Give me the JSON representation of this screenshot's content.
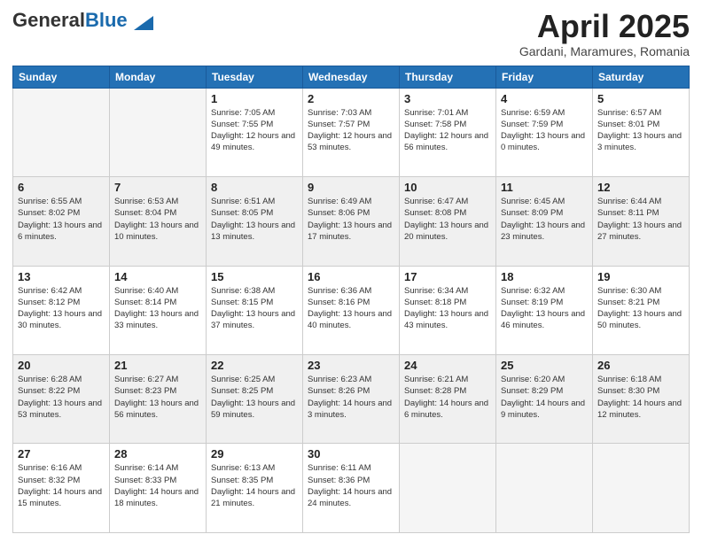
{
  "header": {
    "logo_general": "General",
    "logo_blue": "Blue",
    "month_title": "April 2025",
    "location": "Gardani, Maramures, Romania"
  },
  "weekdays": [
    "Sunday",
    "Monday",
    "Tuesday",
    "Wednesday",
    "Thursday",
    "Friday",
    "Saturday"
  ],
  "weeks": [
    [
      {
        "day": "",
        "sunrise": "",
        "sunset": "",
        "daylight": ""
      },
      {
        "day": "",
        "sunrise": "",
        "sunset": "",
        "daylight": ""
      },
      {
        "day": "1",
        "sunrise": "Sunrise: 7:05 AM",
        "sunset": "Sunset: 7:55 PM",
        "daylight": "Daylight: 12 hours and 49 minutes."
      },
      {
        "day": "2",
        "sunrise": "Sunrise: 7:03 AM",
        "sunset": "Sunset: 7:57 PM",
        "daylight": "Daylight: 12 hours and 53 minutes."
      },
      {
        "day": "3",
        "sunrise": "Sunrise: 7:01 AM",
        "sunset": "Sunset: 7:58 PM",
        "daylight": "Daylight: 12 hours and 56 minutes."
      },
      {
        "day": "4",
        "sunrise": "Sunrise: 6:59 AM",
        "sunset": "Sunset: 7:59 PM",
        "daylight": "Daylight: 13 hours and 0 minutes."
      },
      {
        "day": "5",
        "sunrise": "Sunrise: 6:57 AM",
        "sunset": "Sunset: 8:01 PM",
        "daylight": "Daylight: 13 hours and 3 minutes."
      }
    ],
    [
      {
        "day": "6",
        "sunrise": "Sunrise: 6:55 AM",
        "sunset": "Sunset: 8:02 PM",
        "daylight": "Daylight: 13 hours and 6 minutes."
      },
      {
        "day": "7",
        "sunrise": "Sunrise: 6:53 AM",
        "sunset": "Sunset: 8:04 PM",
        "daylight": "Daylight: 13 hours and 10 minutes."
      },
      {
        "day": "8",
        "sunrise": "Sunrise: 6:51 AM",
        "sunset": "Sunset: 8:05 PM",
        "daylight": "Daylight: 13 hours and 13 minutes."
      },
      {
        "day": "9",
        "sunrise": "Sunrise: 6:49 AM",
        "sunset": "Sunset: 8:06 PM",
        "daylight": "Daylight: 13 hours and 17 minutes."
      },
      {
        "day": "10",
        "sunrise": "Sunrise: 6:47 AM",
        "sunset": "Sunset: 8:08 PM",
        "daylight": "Daylight: 13 hours and 20 minutes."
      },
      {
        "day": "11",
        "sunrise": "Sunrise: 6:45 AM",
        "sunset": "Sunset: 8:09 PM",
        "daylight": "Daylight: 13 hours and 23 minutes."
      },
      {
        "day": "12",
        "sunrise": "Sunrise: 6:44 AM",
        "sunset": "Sunset: 8:11 PM",
        "daylight": "Daylight: 13 hours and 27 minutes."
      }
    ],
    [
      {
        "day": "13",
        "sunrise": "Sunrise: 6:42 AM",
        "sunset": "Sunset: 8:12 PM",
        "daylight": "Daylight: 13 hours and 30 minutes."
      },
      {
        "day": "14",
        "sunrise": "Sunrise: 6:40 AM",
        "sunset": "Sunset: 8:14 PM",
        "daylight": "Daylight: 13 hours and 33 minutes."
      },
      {
        "day": "15",
        "sunrise": "Sunrise: 6:38 AM",
        "sunset": "Sunset: 8:15 PM",
        "daylight": "Daylight: 13 hours and 37 minutes."
      },
      {
        "day": "16",
        "sunrise": "Sunrise: 6:36 AM",
        "sunset": "Sunset: 8:16 PM",
        "daylight": "Daylight: 13 hours and 40 minutes."
      },
      {
        "day": "17",
        "sunrise": "Sunrise: 6:34 AM",
        "sunset": "Sunset: 8:18 PM",
        "daylight": "Daylight: 13 hours and 43 minutes."
      },
      {
        "day": "18",
        "sunrise": "Sunrise: 6:32 AM",
        "sunset": "Sunset: 8:19 PM",
        "daylight": "Daylight: 13 hours and 46 minutes."
      },
      {
        "day": "19",
        "sunrise": "Sunrise: 6:30 AM",
        "sunset": "Sunset: 8:21 PM",
        "daylight": "Daylight: 13 hours and 50 minutes."
      }
    ],
    [
      {
        "day": "20",
        "sunrise": "Sunrise: 6:28 AM",
        "sunset": "Sunset: 8:22 PM",
        "daylight": "Daylight: 13 hours and 53 minutes."
      },
      {
        "day": "21",
        "sunrise": "Sunrise: 6:27 AM",
        "sunset": "Sunset: 8:23 PM",
        "daylight": "Daylight: 13 hours and 56 minutes."
      },
      {
        "day": "22",
        "sunrise": "Sunrise: 6:25 AM",
        "sunset": "Sunset: 8:25 PM",
        "daylight": "Daylight: 13 hours and 59 minutes."
      },
      {
        "day": "23",
        "sunrise": "Sunrise: 6:23 AM",
        "sunset": "Sunset: 8:26 PM",
        "daylight": "Daylight: 14 hours and 3 minutes."
      },
      {
        "day": "24",
        "sunrise": "Sunrise: 6:21 AM",
        "sunset": "Sunset: 8:28 PM",
        "daylight": "Daylight: 14 hours and 6 minutes."
      },
      {
        "day": "25",
        "sunrise": "Sunrise: 6:20 AM",
        "sunset": "Sunset: 8:29 PM",
        "daylight": "Daylight: 14 hours and 9 minutes."
      },
      {
        "day": "26",
        "sunrise": "Sunrise: 6:18 AM",
        "sunset": "Sunset: 8:30 PM",
        "daylight": "Daylight: 14 hours and 12 minutes."
      }
    ],
    [
      {
        "day": "27",
        "sunrise": "Sunrise: 6:16 AM",
        "sunset": "Sunset: 8:32 PM",
        "daylight": "Daylight: 14 hours and 15 minutes."
      },
      {
        "day": "28",
        "sunrise": "Sunrise: 6:14 AM",
        "sunset": "Sunset: 8:33 PM",
        "daylight": "Daylight: 14 hours and 18 minutes."
      },
      {
        "day": "29",
        "sunrise": "Sunrise: 6:13 AM",
        "sunset": "Sunset: 8:35 PM",
        "daylight": "Daylight: 14 hours and 21 minutes."
      },
      {
        "day": "30",
        "sunrise": "Sunrise: 6:11 AM",
        "sunset": "Sunset: 8:36 PM",
        "daylight": "Daylight: 14 hours and 24 minutes."
      },
      {
        "day": "",
        "sunrise": "",
        "sunset": "",
        "daylight": ""
      },
      {
        "day": "",
        "sunrise": "",
        "sunset": "",
        "daylight": ""
      },
      {
        "day": "",
        "sunrise": "",
        "sunset": "",
        "daylight": ""
      }
    ]
  ]
}
